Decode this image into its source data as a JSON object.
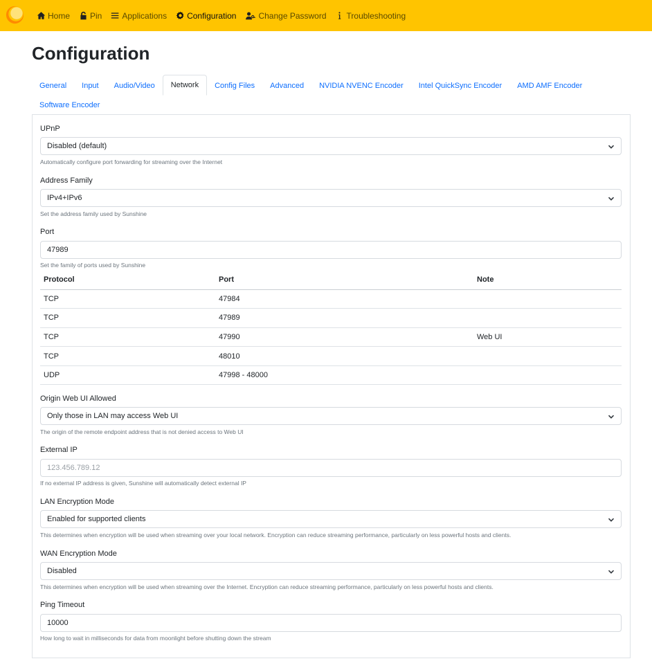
{
  "nav": {
    "items": [
      {
        "label": "Home",
        "icon": "home-icon"
      },
      {
        "label": "Pin",
        "icon": "lock-icon"
      },
      {
        "label": "Applications",
        "icon": "list-icon"
      },
      {
        "label": "Configuration",
        "icon": "gear-icon"
      },
      {
        "label": "Change Password",
        "icon": "user-key-icon"
      },
      {
        "label": "Troubleshooting",
        "icon": "info-icon"
      }
    ],
    "active": "Configuration",
    "bar_color": "#ffc400"
  },
  "page": {
    "title": "Configuration"
  },
  "tabs": {
    "items": [
      "General",
      "Input",
      "Audio/Video",
      "Network",
      "Config Files",
      "Advanced",
      "NVIDIA NVENC Encoder",
      "Intel QuickSync Encoder",
      "AMD AMF Encoder",
      "Software Encoder"
    ],
    "active": "Network"
  },
  "form": {
    "upnp": {
      "label": "UPnP",
      "value": "Disabled (default)",
      "help": "Automatically configure port forwarding for streaming over the Internet"
    },
    "address_family": {
      "label": "Address Family",
      "value": "IPv4+IPv6",
      "help": "Set the address family used by Sunshine"
    },
    "port": {
      "label": "Port",
      "value": "47989",
      "help": "Set the family of ports used by Sunshine"
    },
    "port_table": {
      "headers": [
        "Protocol",
        "Port",
        "Note"
      ],
      "rows": [
        [
          "TCP",
          "47984",
          ""
        ],
        [
          "TCP",
          "47989",
          ""
        ],
        [
          "TCP",
          "47990",
          "Web UI"
        ],
        [
          "TCP",
          "48010",
          ""
        ],
        [
          "UDP",
          "47998 - 48000",
          ""
        ]
      ]
    },
    "origin_web_ui": {
      "label": "Origin Web UI Allowed",
      "value": "Only those in LAN may access Web UI",
      "help": "The origin of the remote endpoint address that is not denied access to Web UI"
    },
    "external_ip": {
      "label": "External IP",
      "placeholder": "123.456.789.12",
      "help": "If no external IP address is given, Sunshine will automatically detect external IP"
    },
    "lan_encryption": {
      "label": "LAN Encryption Mode",
      "value": "Enabled for supported clients",
      "help": "This determines when encryption will be used when streaming over your local network. Encryption can reduce streaming performance, particularly on less powerful hosts and clients."
    },
    "wan_encryption": {
      "label": "WAN Encryption Mode",
      "value": "Disabled",
      "help": "This determines when encryption will be used when streaming over the Internet. Encryption can reduce streaming performance, particularly on less powerful hosts and clients."
    },
    "ping_timeout": {
      "label": "Ping Timeout",
      "value": "10000",
      "help": "How long to wait in milliseconds for data from moonlight before shutting down the stream"
    }
  }
}
